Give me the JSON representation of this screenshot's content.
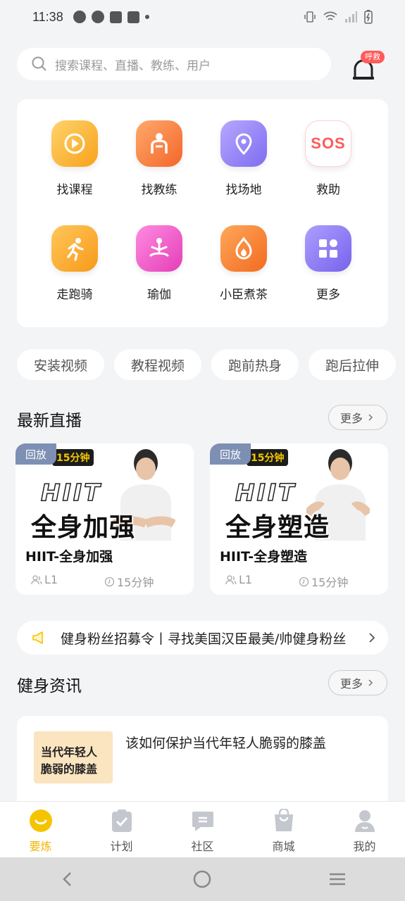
{
  "status_bar": {
    "time": "11:38"
  },
  "search": {
    "placeholder": "搜索课程、直播、教练、用户"
  },
  "alarm": {
    "badge": "呼救"
  },
  "grid": {
    "items": [
      {
        "label": "找课程",
        "icon": "play-course-icon",
        "color": "#f7b427"
      },
      {
        "label": "找教练",
        "icon": "coach-icon",
        "color": "#f77b3a"
      },
      {
        "label": "找场地",
        "icon": "location-pin-icon",
        "color": "#8b7cf6"
      },
      {
        "label": "救助",
        "icon": "sos-icon",
        "color": "#ff5a5a"
      },
      {
        "label": "走跑骑",
        "icon": "running-icon",
        "color": "#f7a025"
      },
      {
        "label": "瑜伽",
        "icon": "yoga-icon",
        "color": "#e94fc1"
      },
      {
        "label": "小臣煮茶",
        "icon": "flame-icon",
        "color": "#f47c2c"
      },
      {
        "label": "更多",
        "icon": "more-grid-icon",
        "color": "#8676f0"
      }
    ]
  },
  "chips": [
    "安装视频",
    "教程视频",
    "跑前热身",
    "跑后拉伸"
  ],
  "live_section": {
    "title": "最新直播",
    "more": "更多",
    "cards": [
      {
        "badge": "回放",
        "duration_tag": "15分钟",
        "thumb_en": "HIIT",
        "thumb_cn": "全身加强",
        "name": "HIIT-全身加强",
        "level": "L1",
        "duration": "15分钟"
      },
      {
        "badge": "回放",
        "duration_tag": "15分钟",
        "thumb_en": "HIIT",
        "thumb_cn": "全身塑造",
        "name": "HIIT-全身塑造",
        "level": "L1",
        "duration": "15分钟"
      }
    ]
  },
  "notice": {
    "text": "健身粉丝招募令丨寻找美国汉臣最美/帅健身粉丝"
  },
  "news_section": {
    "title": "健身资讯",
    "more": "更多",
    "item": {
      "thumb_line1": "当代年轻人",
      "thumb_line2": "脆弱的膝盖",
      "title": "该如何保护当代年轻人脆弱的膝盖"
    }
  },
  "tabbar": {
    "active_color": "#f2b600",
    "tabs": [
      {
        "label": "要炼",
        "active": true
      },
      {
        "label": "计划",
        "active": false
      },
      {
        "label": "社区",
        "active": false
      },
      {
        "label": "商城",
        "active": false
      },
      {
        "label": "我的",
        "active": false
      }
    ]
  }
}
